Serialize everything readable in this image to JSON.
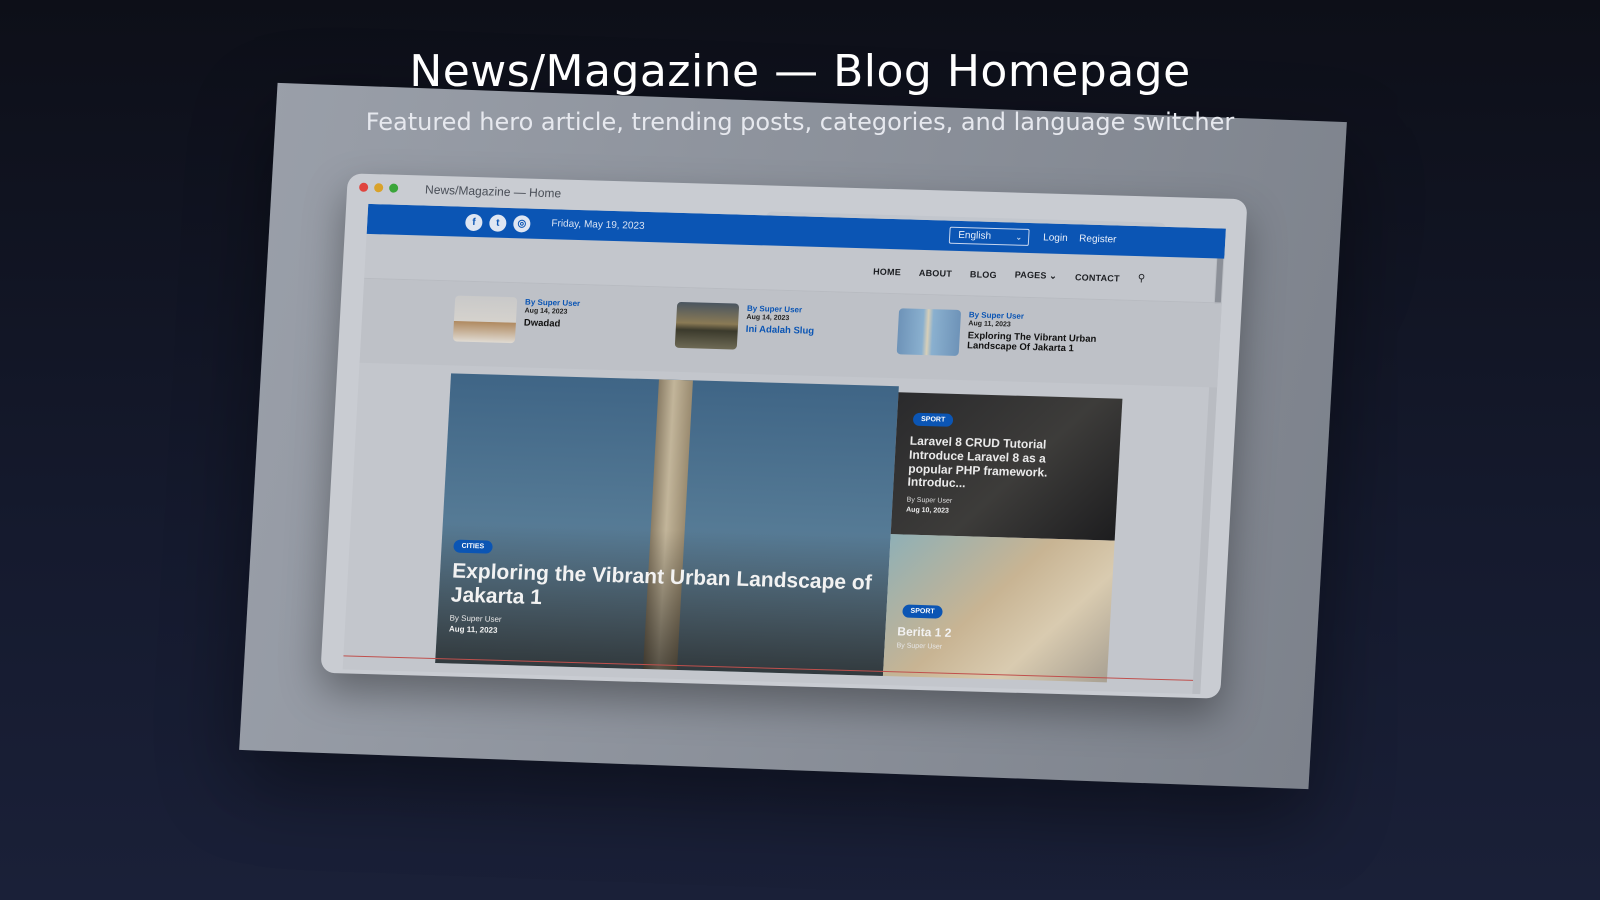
{
  "page": {
    "title": "News/Magazine — Blog Homepage",
    "subtitle": "Featured hero article, trending posts, categories, and language switcher"
  },
  "browser": {
    "window_title": "News/Magazine — Home"
  },
  "topbar": {
    "social_icons": [
      "facebook-icon",
      "twitter-icon",
      "instagram-icon"
    ],
    "date": "Friday, May 19, 2023",
    "language": "English",
    "login": "Login",
    "register": "Register"
  },
  "nav": {
    "items": [
      "HOME",
      "ABOUT",
      "BLOG",
      "PAGES",
      "CONTACT"
    ],
    "search_icon": "search-icon"
  },
  "trending": [
    {
      "author": "By Super User",
      "date": "Aug 14, 2023",
      "title": "Dwadad"
    },
    {
      "author": "By Super User",
      "date": "Aug 14, 2023",
      "title": "Ini Adalah Slug"
    },
    {
      "author": "By Super User",
      "date": "Aug 11, 2023",
      "title": "Exploring The Vibrant Urban Landscape Of Jakarta 1"
    }
  ],
  "hero": {
    "category": "CITIES",
    "title": "Exploring the Vibrant Urban Landscape of Jakarta 1",
    "author": "By Super User",
    "date": "Aug 11, 2023"
  },
  "side_posts": [
    {
      "category": "SPORT",
      "title": "Laravel 8 CRUD Tutorial Introduce Laravel 8 as a popular PHP framework. Introduc...",
      "author": "By Super User",
      "date": "Aug 10, 2023"
    },
    {
      "category": "SPORT",
      "title": "Berita 1 2",
      "author": "By Super User"
    }
  ],
  "colors": {
    "brand_blue": "#0b55b4",
    "accent_red": "#c0504d"
  }
}
